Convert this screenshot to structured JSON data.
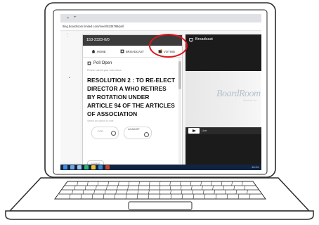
{
  "browser": {
    "tab_close": "×",
    "tab_new": "+",
    "address": "lting.boardroom limited.com/meet/5236789/poll"
  },
  "panel": {
    "header_title": "153-2323-0/0",
    "nav": {
      "home": "HOME",
      "broadcast": "BROADCAST",
      "voting": "VOTING"
    },
    "poll_title": "Poll Open",
    "poll_subtitle": "Please submit your vote below",
    "resolution_text": "RESOLUTION 2 : TO RE-ELECT DIRECTOR A WHO RETIRES BY ROTATION UNDER ARTICLE 94 OF THE ARTICLES OF ASSOCIATION",
    "select_label": "Select an option to vote",
    "options": [
      "FOR",
      "AGAINST"
    ],
    "submit_label": "SUBMIT"
  },
  "broadcast": {
    "title": "Broadcast",
    "video_logo": "BoardRoom",
    "video_sub": "Services Ltd",
    "control_label": "Live"
  },
  "taskbar": {
    "tray_text": "10:24"
  },
  "colors": {
    "annotation": "#e0141b",
    "panel_header": "#3b3b3b",
    "taskbar": "#10243f"
  },
  "icons": [
    "home-icon",
    "broadcast-icon",
    "voting-icon",
    "poll-icon",
    "play-icon",
    "monitor-icon"
  ]
}
